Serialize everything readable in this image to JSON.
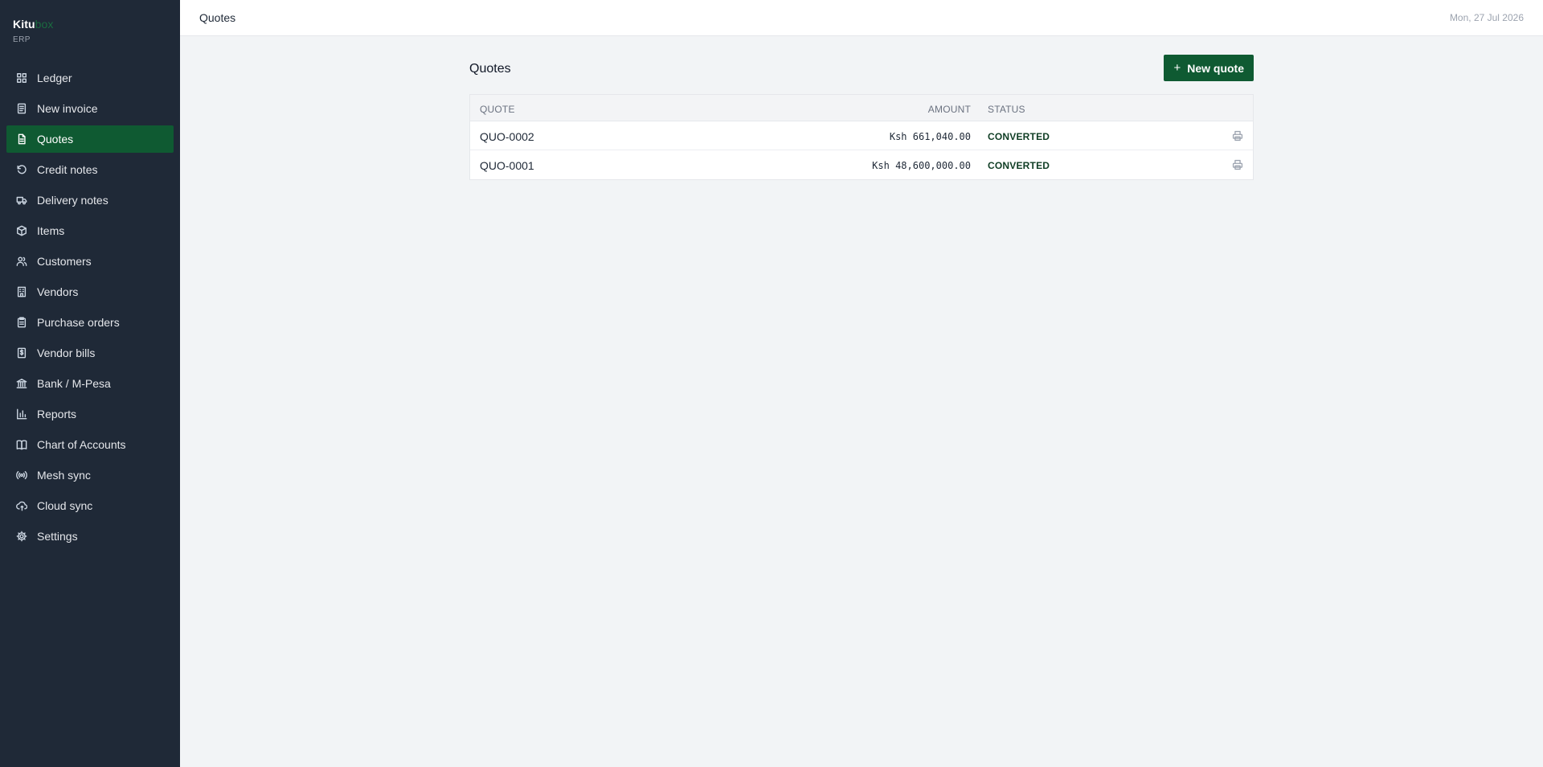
{
  "brand": {
    "name_part1": "Kitu",
    "name_part2": "box",
    "subtitle": "ERP"
  },
  "sidebar": {
    "items": [
      {
        "label": "Ledger",
        "icon": "grid-icon",
        "active": false
      },
      {
        "label": "New invoice",
        "icon": "document-icon",
        "active": false
      },
      {
        "label": "Quotes",
        "icon": "file-text-icon",
        "active": true
      },
      {
        "label": "Credit notes",
        "icon": "rotate-ccw-icon",
        "active": false
      },
      {
        "label": "Delivery notes",
        "icon": "truck-icon",
        "active": false
      },
      {
        "label": "Items",
        "icon": "package-icon",
        "active": false
      },
      {
        "label": "Customers",
        "icon": "users-icon",
        "active": false
      },
      {
        "label": "Vendors",
        "icon": "building-icon",
        "active": false
      },
      {
        "label": "Purchase orders",
        "icon": "clipboard-icon",
        "active": false
      },
      {
        "label": "Vendor bills",
        "icon": "receipt-icon",
        "active": false
      },
      {
        "label": "Bank / M-Pesa",
        "icon": "bank-icon",
        "active": false
      },
      {
        "label": "Reports",
        "icon": "bar-chart-icon",
        "active": false
      },
      {
        "label": "Chart of Accounts",
        "icon": "book-icon",
        "active": false
      },
      {
        "label": "Mesh sync",
        "icon": "radio-icon",
        "active": false
      },
      {
        "label": "Cloud sync",
        "icon": "cloud-sync-icon",
        "active": false
      },
      {
        "label": "Settings",
        "icon": "gear-icon",
        "active": false
      }
    ]
  },
  "topbar": {
    "title": "Quotes",
    "date": "Mon, 27 Jul 2026"
  },
  "main": {
    "title": "Quotes",
    "new_button_label": "New quote",
    "table": {
      "headers": {
        "quote": "QUOTE",
        "amount": "AMOUNT",
        "status": "STATUS"
      },
      "rows": [
        {
          "quote": "QUO-0002",
          "amount": "Ksh 661,040.00",
          "status": "CONVERTED"
        },
        {
          "quote": "QUO-0001",
          "amount": "Ksh 48,600,000.00",
          "status": "CONVERTED"
        }
      ]
    }
  },
  "colors": {
    "sidebar_bg": "#1f2937",
    "accent": "#0f5a32",
    "page_bg": "#f2f4f6"
  }
}
